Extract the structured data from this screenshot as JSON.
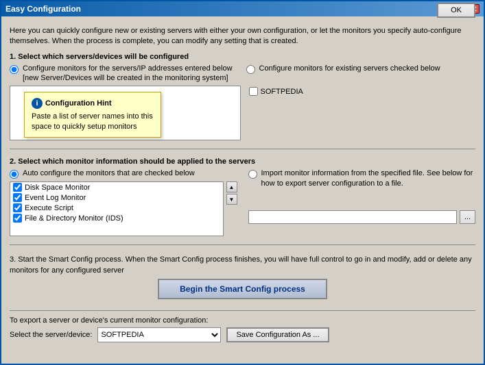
{
  "titlebar": {
    "title": "Easy Configuration",
    "close_label": "✕"
  },
  "ok_button": "OK",
  "intro": {
    "text": "Here you can quickly configure new or existing servers with either your own configuration, or let the monitors you specify auto-configure themselves.  When the process is complete, you can modify any setting that is created."
  },
  "step1": {
    "label": "1. Select which servers/devices will be configured",
    "radio1_label": "Configure monitors for the servers/IP addresses entered below [new Server/Devices will be created in the monitoring system]",
    "radio2_label": "Configure monitors for existing servers checked below"
  },
  "hint": {
    "title": "Configuration Hint",
    "text": "Paste a list of server names into this space to quickly setup monitors",
    "icon": "i"
  },
  "server_checkbox": {
    "label": "SOFTPEDIA",
    "checked": false
  },
  "step2": {
    "label": "2. Select which monitor information should be applied to the servers",
    "radio1_label": "Auto configure the monitors that are checked below",
    "radio2_label": "Import monitor information from the specified file.  See below for how to export server configuration to a file."
  },
  "monitors": [
    {
      "label": "Disk Space Monitor",
      "checked": true
    },
    {
      "label": "Event Log Monitor",
      "checked": true
    },
    {
      "label": "Execute Script",
      "checked": true
    },
    {
      "label": "File & Directory Monitor (IDS)",
      "checked": true
    }
  ],
  "scroll_up": "▲",
  "scroll_down": "▼",
  "file_input_placeholder": "",
  "browse_btn": "...",
  "step3": {
    "label": "3. Start the Smart Config process.  When the Smart Config process finishes, you will have full control to go in and modify, add or delete any monitors for any configured server"
  },
  "smart_config_btn": "Begin the Smart Config process",
  "export": {
    "label": "To export a server or device's current monitor configuration:",
    "device_label": "Select the server/device:",
    "device_value": "SOFTPEDIA",
    "save_btn": "Save Configuration As ..."
  }
}
